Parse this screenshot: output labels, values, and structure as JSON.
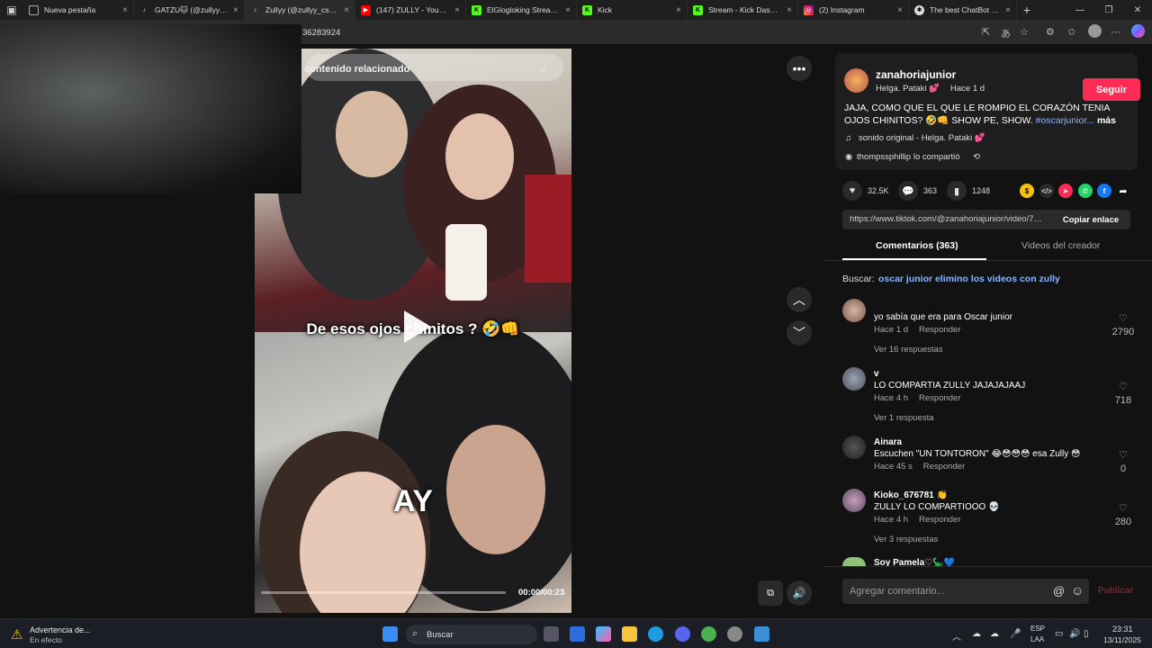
{
  "browser": {
    "tabs": [
      {
        "title": "Nueva pestaña",
        "icon": "page-icon"
      },
      {
        "title": "GATZU🐱 (@zullyy3.0)",
        "icon": "tiktok-icon"
      },
      {
        "title": "Zullyy (@zullyy_cs) ofi",
        "icon": "tiktok-icon"
      },
      {
        "title": "(147) ZULLY - YouTube",
        "icon": "youtube-icon"
      },
      {
        "title": "ElGlogloking Stream - ",
        "icon": "kick-icon"
      },
      {
        "title": "Kick",
        "icon": "kick-icon"
      },
      {
        "title": "Stream - Kick Dashboar",
        "icon": "kick-icon"
      },
      {
        "title": "(2) Instagram",
        "icon": "instagram-icon"
      },
      {
        "title": "The best ChatBot and",
        "icon": "chatbot-icon"
      }
    ],
    "active_tab": 2,
    "url_fragment": "36283924",
    "new_tab": "+",
    "close": "×"
  },
  "video": {
    "search_text": "contenido relacionado",
    "caption_top": "De esos ojos chinitos ? 🤣👊",
    "caption_bottom": "AY",
    "time": "00:00/00:23",
    "progress": 0
  },
  "post": {
    "username": "zanahoriajunior",
    "nickname": "Helga. Pataki 💕",
    "ago": "Hace 1 d",
    "follow": "Seguir",
    "description": "JAJA, COMO QUE EL QUE LE ROMPIO EL CORAZÓN TENIA OJOS CHINITOS? 🤣👊 SHOW PE, SHOW. ",
    "hashtag": "#oscarjunior...",
    "more": "más",
    "sound": "sonido original - Helga. Pataki 💕",
    "shared_by": "thompssphillip lo compartió",
    "likes": "32.5K",
    "comments": "363",
    "saves": "1248",
    "link": "https://www.tiktok.com/@zanahoriajunior/video/75...",
    "copy_link": "Copiar enlace",
    "tab_comments": "Comentarios (363)",
    "tab_videos": "Videos del creador",
    "search_prefix": "Buscar:",
    "search_query": "oscar junior elimino los videos con zully"
  },
  "comments": [
    {
      "name": "",
      "text": "yo sabía que era para Oscar junior",
      "time": "Hace 1 d",
      "reply": "Responder",
      "likes": "2790",
      "replies": "Ver 16 respuestas"
    },
    {
      "name": "v",
      "text": "LO COMPARTIA ZULLY JAJAJAJAAJ",
      "time": "Hace 4 h",
      "reply": "Responder",
      "likes": "718",
      "replies": "Ver 1 respuesta"
    },
    {
      "name": "Ainara",
      "text": "Escuchen \"UN TONTORON\" 😂😳😳😳 esa Zully 😳",
      "time": "Hace 45 s",
      "reply": "Responder",
      "likes": "0",
      "replies": ""
    },
    {
      "name": "Kioko_676781 👏",
      "text": "ZULLY LO COMPARTIOOO 💀",
      "time": "Hace 4 h",
      "reply": "Responder",
      "likes": "280",
      "replies": "Ver 3 respuestas"
    },
    {
      "name": "Soy Pamela♡🦕💙",
      "text": "",
      "time": "",
      "reply": "",
      "likes": "",
      "replies": ""
    }
  ],
  "comment_input": {
    "placeholder": "Agregar comentario...",
    "publish": "Publicar",
    "at": "@"
  },
  "taskbar": {
    "warning_title": "Advertencia de...",
    "warning_sub": "En efecto",
    "search": "Buscar",
    "lang1": "ESP",
    "lang2": "LAA",
    "time": "23:31",
    "date": "13/11/2025"
  },
  "colors": {
    "accent": "#fe2c55",
    "hashtag": "#8ab4ff",
    "panel": "#1e1e1e"
  }
}
